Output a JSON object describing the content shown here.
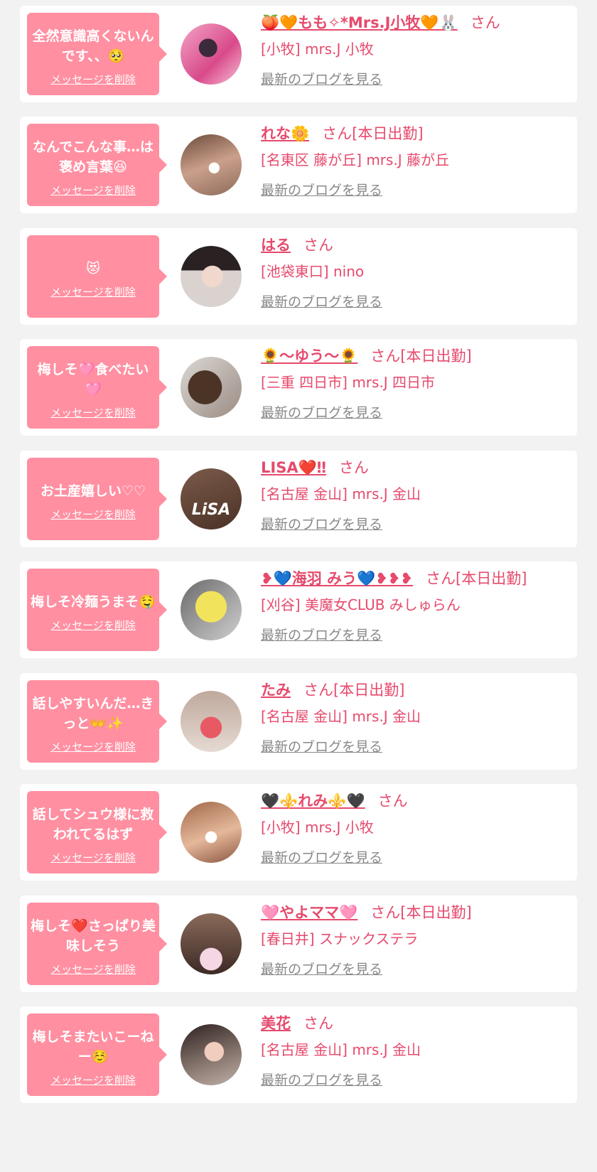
{
  "delete_label": "メッセージを削除",
  "blog_label": "最新のブログを見る",
  "items": [
    {
      "message": "全然意識高くないんです、、🥺",
      "name": "🍑🧡もも✧*Mrs.J小牧🧡🐰",
      "suffix": "さん",
      "shop": "[小牧] mrs.J 小牧",
      "avatar": "avatar-photo-pink"
    },
    {
      "message": "なんでこんな事…は褒め言葉😆",
      "name": "れな🌼",
      "suffix": "さん[本日出勤]",
      "shop": "[名東区 藤が丘] mrs.J 藤が丘",
      "avatar": "avatar-photo-heart"
    },
    {
      "message": "😻",
      "name": "はる",
      "suffix": "さん",
      "shop": "[池袋東口] nino",
      "avatar": "avatar-photo-face"
    },
    {
      "message": "梅しそ🩷食べたい🩷",
      "name": "🌻〜ゆう〜🌻",
      "suffix": "さん[本日出勤]",
      "shop": "[三重 四日市] mrs.J 四日市",
      "avatar": "avatar-photo-hair"
    },
    {
      "message": "お土産嬉しい♡♡",
      "name": "LISA❤️‼",
      "suffix": "さん",
      "shop": "[名古屋 金山] mrs.J 金山",
      "avatar": "avatar-lisa-logo",
      "avatar_text": "LiSA"
    },
    {
      "message": "梅しそ冷麺うまそ🤤",
      "name": "❥💙海羽 みう💙❥❥❥",
      "suffix": "さん[本日出勤]",
      "shop": "[刈谷] 美魔女CLUB みしゅらん",
      "avatar": "avatar-emoji-face"
    },
    {
      "message": "話しやすいんだ…きっと👐✨",
      "name": "たみ",
      "suffix": "さん[本日出勤]",
      "shop": "[名古屋 金山] mrs.J 金山",
      "avatar": "avatar-photo-strawberry"
    },
    {
      "message": "話してシュウ様に救われてるはず",
      "name": "🖤⚜️れみ⚜️🖤",
      "suffix": "さん",
      "shop": "[小牧] mrs.J 小牧",
      "avatar": "avatar-photo-heart2"
    },
    {
      "message": "梅しそ❤️さっぱり美味しそう",
      "name": "🩷やよママ🩷",
      "suffix": "さん[本日出勤]",
      "shop": "[春日井] スナックステラ",
      "avatar": "avatar-photo-flowers"
    },
    {
      "message": "梅しそまたいこーねー☺️",
      "name": "美花",
      "suffix": "さん",
      "shop": "[名古屋 金山] mrs.J 金山",
      "avatar": "avatar-photo-woman"
    }
  ]
}
